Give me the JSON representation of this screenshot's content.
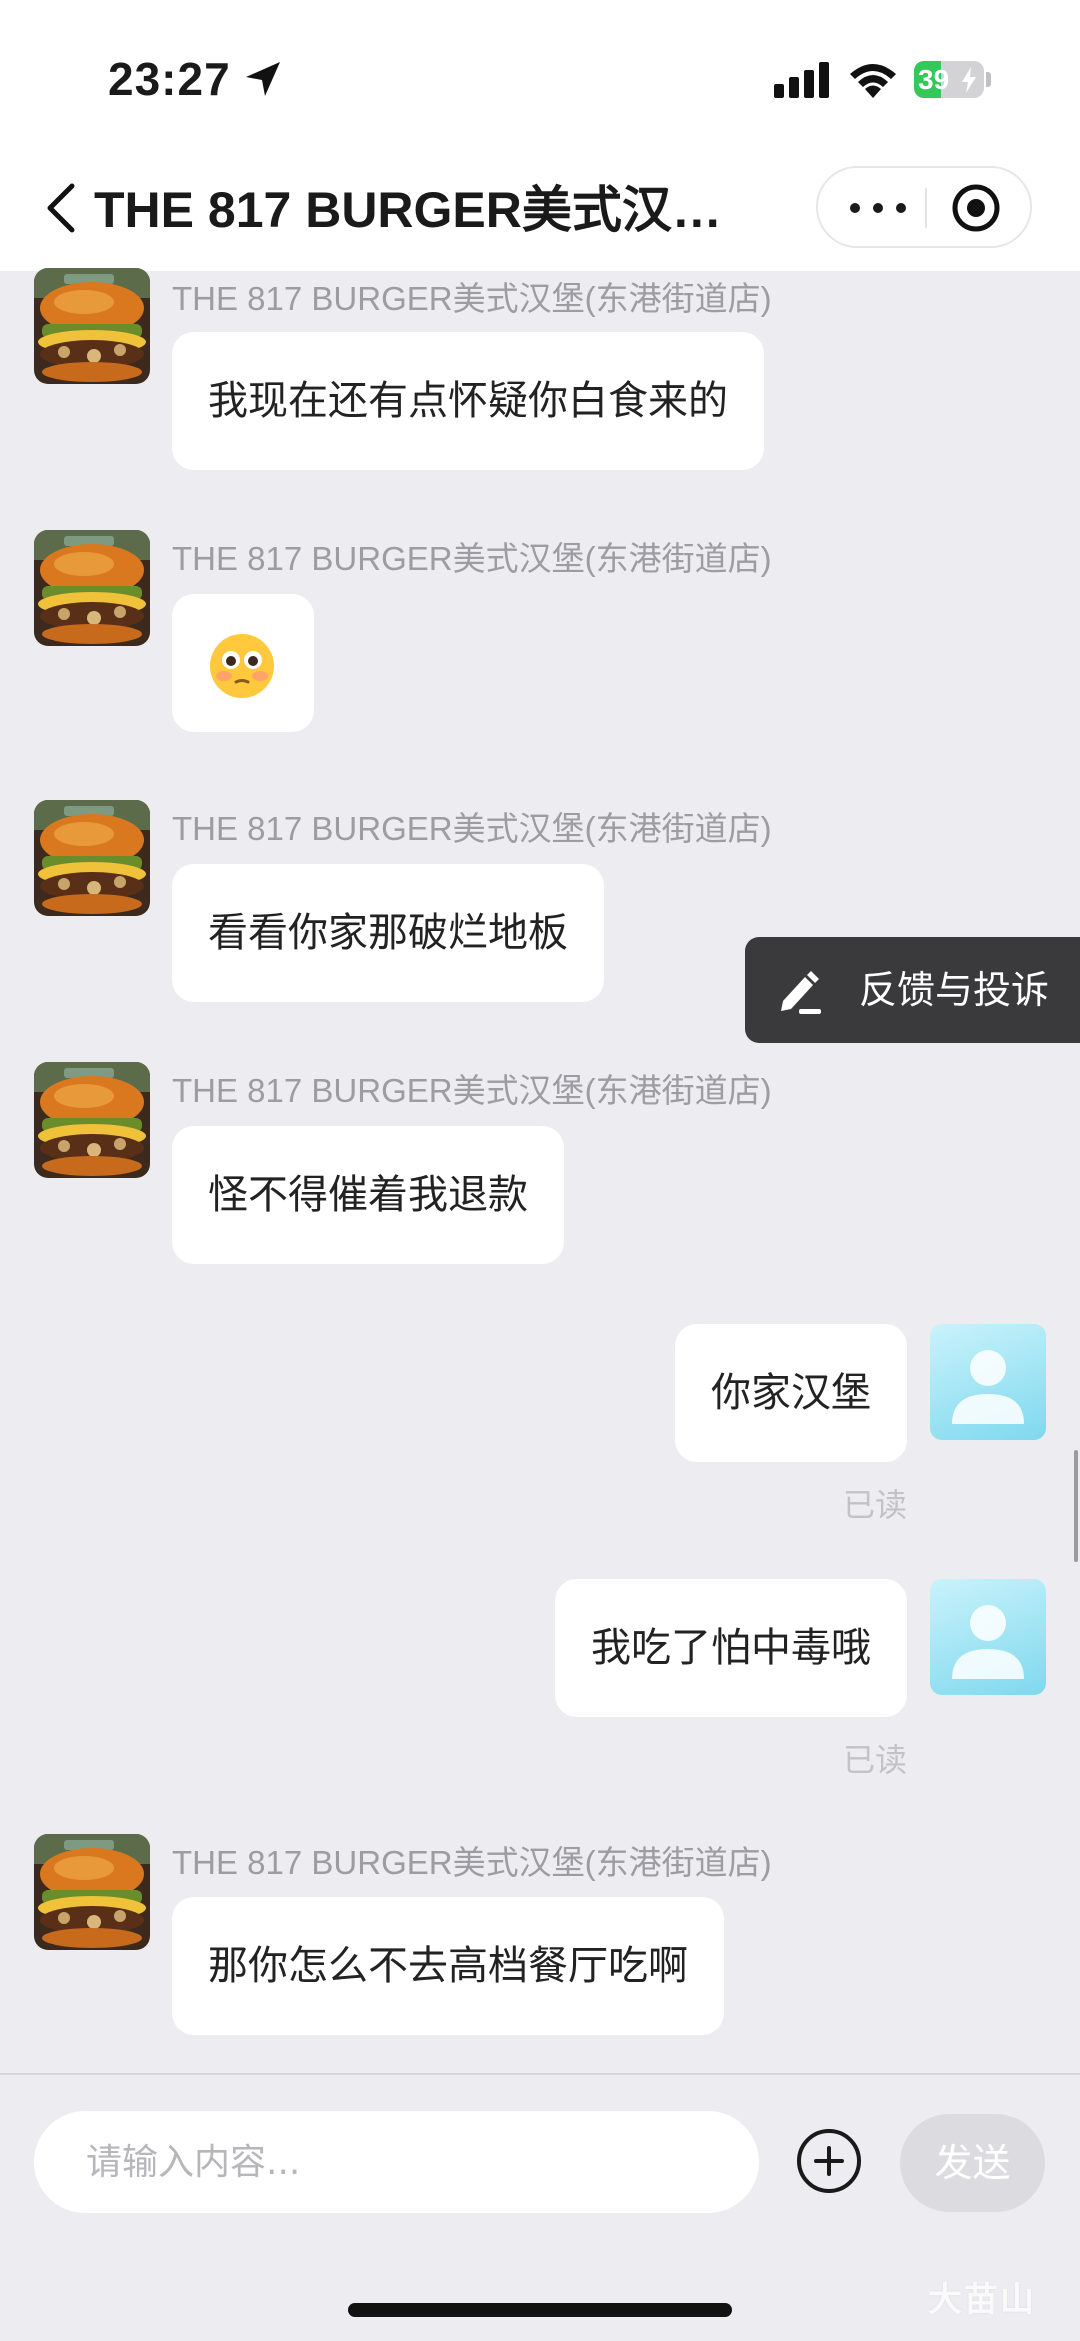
{
  "status_bar": {
    "time": "23:27",
    "battery": "39"
  },
  "nav": {
    "title": "THE 817 BURGER美式汉…"
  },
  "shop_name": "THE 817 BURGER美式汉堡(东港街道店)",
  "messages": [
    {
      "text": "我现在还有点怀疑你白食来的"
    },
    {
      "emoji": "flushed-face-icon"
    },
    {
      "text": "看看你家那破烂地板"
    },
    {
      "text": "怪不得催着我退款"
    },
    {
      "text": "你家汉堡",
      "read": "已读"
    },
    {
      "text": "我吃了怕中毒哦",
      "read": "已读"
    },
    {
      "text": "那你怎么不去高档餐厅吃啊"
    }
  ],
  "feedback": {
    "label": "反馈与投诉"
  },
  "composer": {
    "placeholder": "请输入内容...",
    "send_label": "发送"
  },
  "watermark": "大苗山",
  "colors": {
    "battery_green": "#34c759",
    "feedback_bg": "#3a3a3c",
    "user_avatar": "#8fdcf0"
  }
}
